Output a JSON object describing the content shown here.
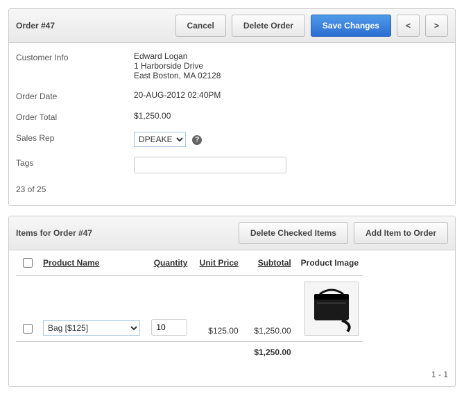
{
  "order": {
    "title": "Order #47",
    "buttons": {
      "cancel": "Cancel",
      "delete": "Delete Order",
      "save": "Save Changes",
      "prev": "<",
      "next": ">"
    },
    "fields": {
      "customer_label": "Customer Info",
      "customer_name": "Edward Logan",
      "customer_addr1": "1 Harborside Drive",
      "customer_addr2": "East Boston, MA 02128",
      "date_label": "Order Date",
      "date_value": "20-AUG-2012 02:40PM",
      "total_label": "Order Total",
      "total_value": "$1,250.00",
      "rep_label": "Sales Rep",
      "rep_value": "DPEAKE",
      "tags_label": "Tags",
      "tags_value": ""
    },
    "record_count": "23 of 25"
  },
  "items": {
    "title": "Items for Order #47",
    "buttons": {
      "delete_checked": "Delete Checked Items",
      "add_item": "Add Item to Order"
    },
    "columns": {
      "product": "Product Name",
      "qty": "Quantity",
      "unit": "Unit Price",
      "subtotal": "Subtotal",
      "image": "Product Image"
    },
    "rows": [
      {
        "product": "Bag [$125]",
        "qty": "10",
        "unit": "$125.00",
        "subtotal": "$1,250.00"
      }
    ],
    "grand_total": "$1,250.00",
    "pager": "1 - 1"
  }
}
